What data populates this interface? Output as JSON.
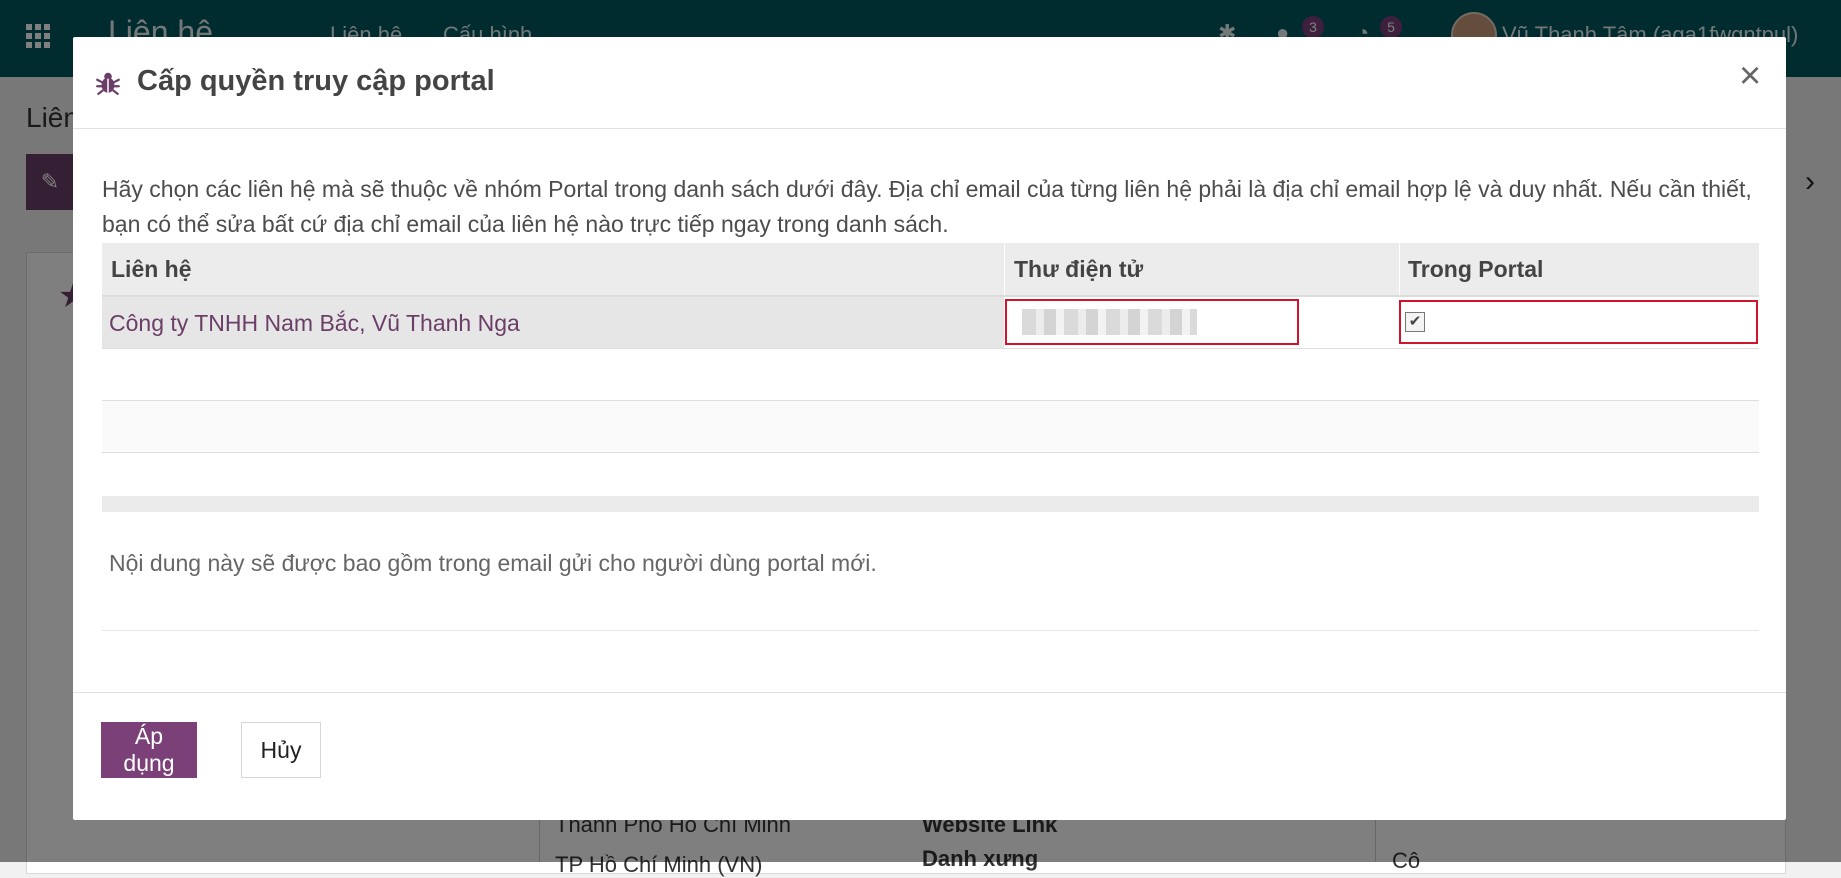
{
  "app": {
    "title": "Liên hệ",
    "menu": [
      "Liên hệ",
      "Cấu hình"
    ],
    "chat_count": "3",
    "activity_count": "5",
    "user_name": "Vũ Thanh Tâm (aga1fwgntpul)",
    "breadcrumb": "Liên",
    "bg_fields": {
      "city_line": "Thành Phố Hồ Chí Minh",
      "country_line": "TP Hồ Chí Minh (VN)",
      "website_label": "Website Link",
      "title_label": "Danh xưng",
      "title_value": "Cô"
    }
  },
  "dialog": {
    "title": "Cấp quyền truy cập portal",
    "close": "×",
    "instructions": "Hãy chọn các liên hệ mà sẽ thuộc về nhóm Portal trong danh sách dưới đây. Địa chỉ email của từng liên hệ phải là địa chỉ email hợp lệ và duy nhất. Nếu cần thiết, bạn có thể sửa bất cứ địa chỉ email của liên hệ nào trực tiếp ngay trong danh sách.",
    "table": {
      "headers": [
        "Liên hệ",
        "Thư điện tử",
        "Trong Portal"
      ],
      "rows": [
        {
          "contact": "Công ty TNHH Nam Bắc, Vũ Thanh Nga",
          "email": "",
          "in_portal": true
        }
      ]
    },
    "note": "Nội dung này sẽ được bao gồm trong email gửi cho người dùng portal mới.",
    "buttons": {
      "apply": "Áp dụng",
      "cancel": "Hủy"
    }
  },
  "colors": {
    "topbar": "#00565f",
    "brand": "#7c4079",
    "link": "#6b3e68",
    "highlight_border": "#d0142c"
  }
}
